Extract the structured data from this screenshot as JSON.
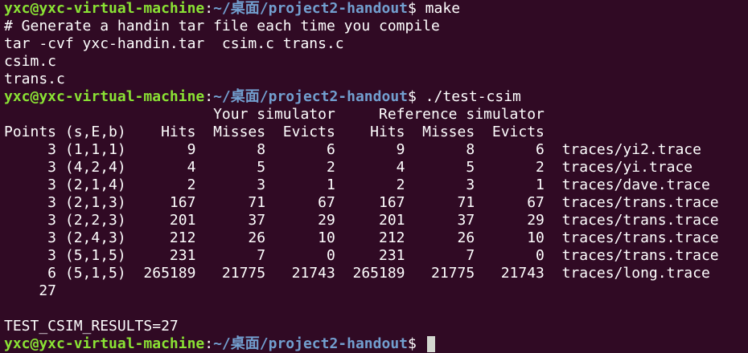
{
  "prompt": {
    "user_host": "yxc@yxc-virtual-machine",
    "sep": ":",
    "path": "~/桌面/project2-handout",
    "dollar": "$"
  },
  "lines": [
    {
      "type": "prompt",
      "cmd": " make"
    },
    {
      "type": "text",
      "text": "# Generate a handin tar file each time you compile"
    },
    {
      "type": "text",
      "text": "tar -cvf yxc-handin.tar  csim.c trans.c"
    },
    {
      "type": "text",
      "text": "csim.c"
    },
    {
      "type": "text",
      "text": "trans.c"
    },
    {
      "type": "prompt",
      "cmd": " ./test-csim"
    },
    {
      "type": "text",
      "text": "                        Your simulator     Reference simulator"
    },
    {
      "type": "text",
      "text": "Points (s,E,b)    Hits  Misses  Evicts    Hits  Misses  Evicts"
    },
    {
      "type": "text",
      "text": "     3 (1,1,1)       9       8       6       9       8       6  traces/yi2.trace"
    },
    {
      "type": "text",
      "text": "     3 (4,2,4)       4       5       2       4       5       2  traces/yi.trace"
    },
    {
      "type": "text",
      "text": "     3 (2,1,4)       2       3       1       2       3       1  traces/dave.trace"
    },
    {
      "type": "text",
      "text": "     3 (2,1,3)     167      71      67     167      71      67  traces/trans.trace"
    },
    {
      "type": "text",
      "text": "     3 (2,2,3)     201      37      29     201      37      29  traces/trans.trace"
    },
    {
      "type": "text",
      "text": "     3 (2,4,3)     212      26      10     212      26      10  traces/trans.trace"
    },
    {
      "type": "text",
      "text": "     3 (5,1,5)     231       7       0     231       7       0  traces/trans.trace"
    },
    {
      "type": "text",
      "text": "     6 (5,1,5)  265189   21775   21743  265189   21775   21743  traces/long.trace"
    },
    {
      "type": "text",
      "text": "    27"
    },
    {
      "type": "text",
      "text": ""
    },
    {
      "type": "text",
      "text": "TEST_CSIM_RESULTS=27"
    },
    {
      "type": "prompt",
      "cmd": " ",
      "cursor": true
    }
  ]
}
